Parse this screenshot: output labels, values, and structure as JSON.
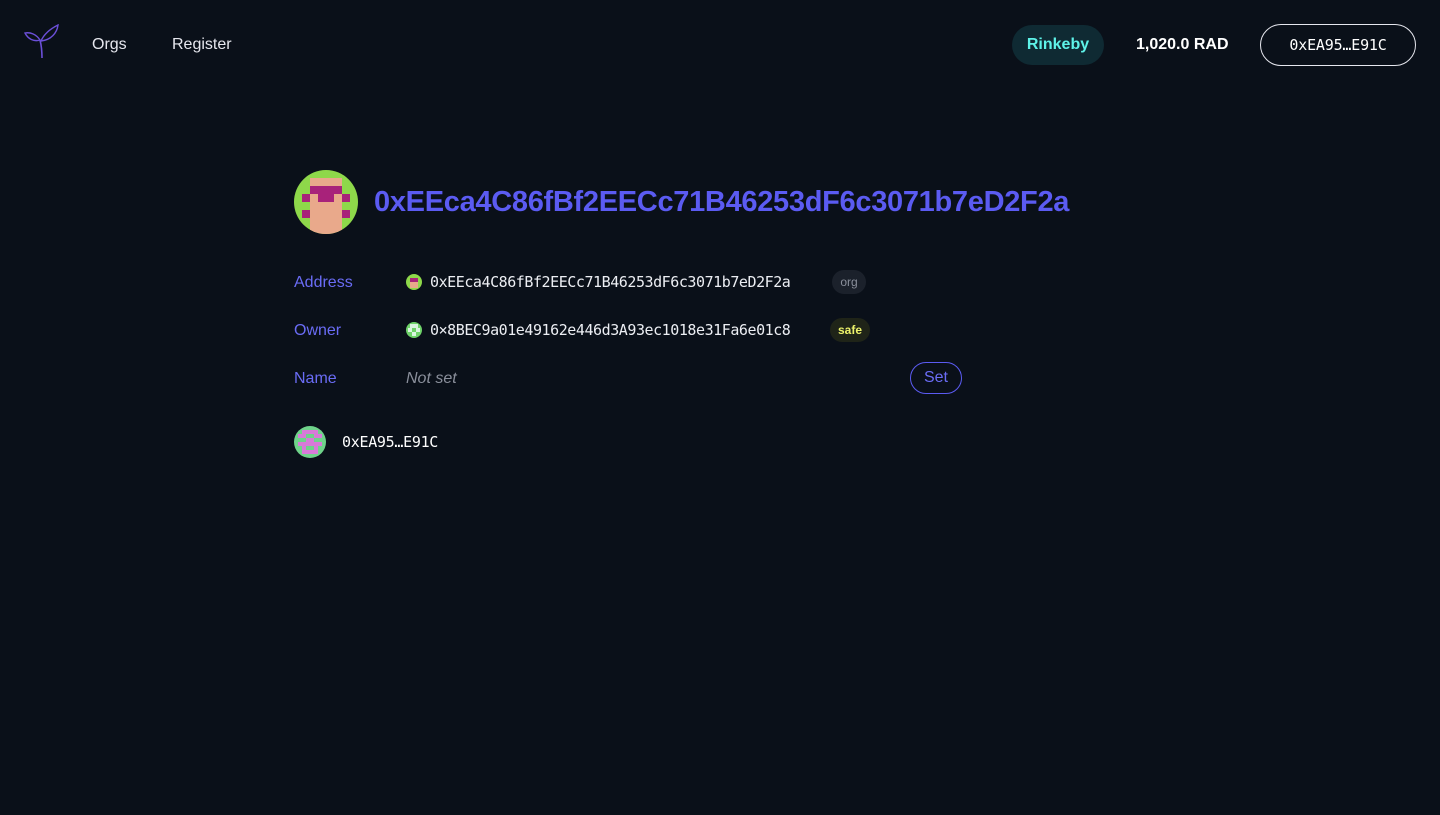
{
  "nav": {
    "orgs_label": "Orgs",
    "register_label": "Register"
  },
  "topbar": {
    "network_label": "Rinkeby",
    "balance_label": "1,020.0 RAD",
    "wallet_label": "0xEA95…E91C"
  },
  "profile": {
    "title": "0xEEca4C86fBf2EECc71B46253dF6c3071b7eD2F2a"
  },
  "fields": {
    "address": {
      "label": "Address",
      "value": "0xEEca4C86fBf2EECc71B46253dF6c3071b7eD2F2a",
      "badge": "org"
    },
    "owner": {
      "label": "Owner",
      "value": "0×8BEC9a01e49162e446d3A93ec1018e31Fa6e01c8",
      "badge": "safe"
    },
    "name": {
      "label": "Name",
      "value": "Not set",
      "action_label": "Set"
    }
  },
  "members": [
    {
      "address": "0xEA95…E91C"
    }
  ],
  "colors": {
    "background": "#0a1019",
    "accent": "#5b5bf2",
    "network_text": "#5ef2e8",
    "network_bg": "#0f2a33",
    "safe_badge_text": "#ecf26a"
  },
  "icons": {
    "logo": "seedling-logo-icon"
  }
}
